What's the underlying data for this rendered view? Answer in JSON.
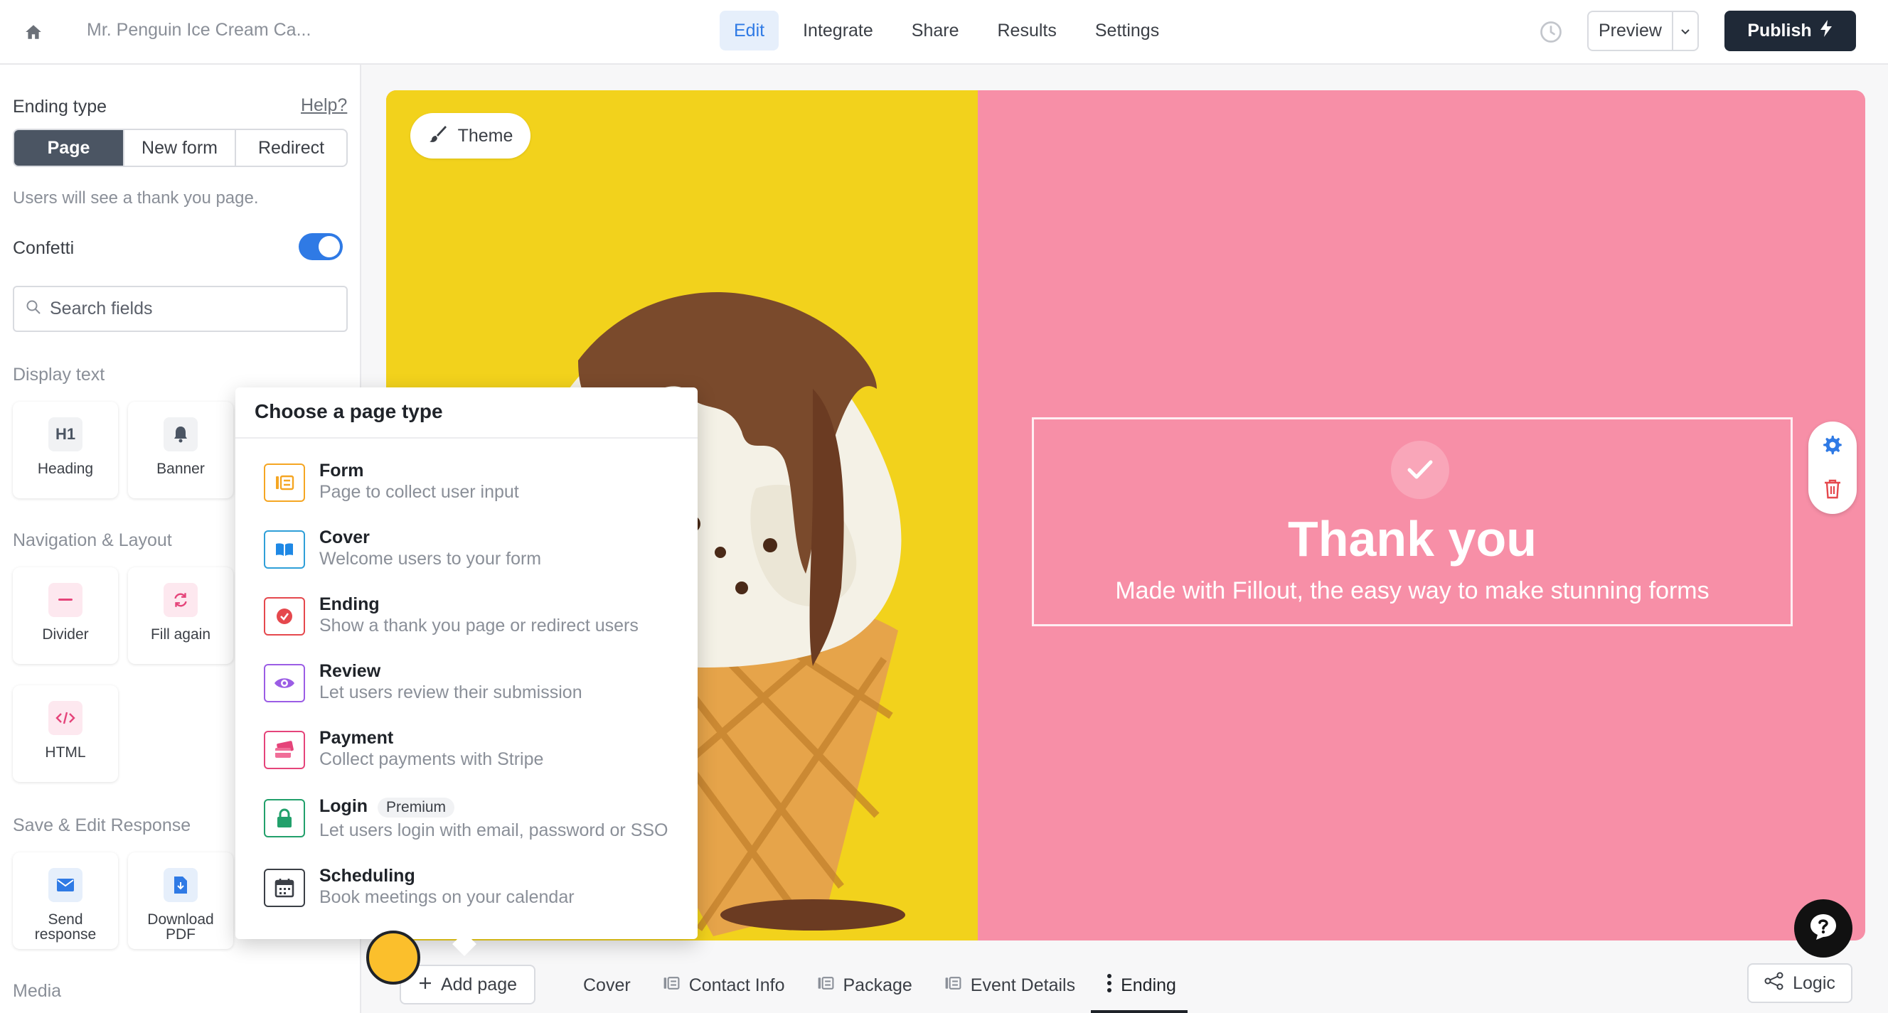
{
  "header": {
    "form_title": "Mr. Penguin Ice Cream Ca...",
    "tabs": [
      {
        "label": "Edit",
        "active": true
      },
      {
        "label": "Integrate"
      },
      {
        "label": "Share"
      },
      {
        "label": "Results"
      },
      {
        "label": "Settings"
      }
    ],
    "preview_label": "Preview",
    "publish_label": "Publish"
  },
  "sidebar": {
    "ending_type_label": "Ending type",
    "help_label": "Help?",
    "ending_options": [
      "Page",
      "New form",
      "Redirect"
    ],
    "selected_ending": "Page",
    "description": "Users will see a thank you page.",
    "confetti_label": "Confetti",
    "confetti_on": true,
    "search_placeholder": "Search fields",
    "sections": {
      "display_text": "Display text",
      "navigation": "Navigation & Layout",
      "save_edit": "Save & Edit Response",
      "media": "Media"
    },
    "tiles": {
      "heading": "Heading",
      "banner": "Banner",
      "divider": "Divider",
      "fill_again": "Fill again",
      "html": "HTML",
      "send_response": "Send response",
      "download_pdf": "Download PDF"
    }
  },
  "canvas": {
    "theme_label": "Theme",
    "thank_you_title": "Thank you",
    "thank_you_subtitle": "Made with Fillout, the easy way to make stunning forms",
    "left_bg": "#f2d21c",
    "right_bg": "#f78fa7"
  },
  "popup": {
    "title": "Choose a page type",
    "items": [
      {
        "name": "Form",
        "desc": "Page to collect user input",
        "icon": "form-icon"
      },
      {
        "name": "Cover",
        "desc": "Welcome users to your form",
        "icon": "cover-icon"
      },
      {
        "name": "Ending",
        "desc": "Show a thank you page or redirect users",
        "icon": "ending-icon"
      },
      {
        "name": "Review",
        "desc": "Let users review their submission",
        "icon": "eye-icon"
      },
      {
        "name": "Payment",
        "desc": "Collect payments with Stripe",
        "icon": "payment-icon"
      },
      {
        "name": "Login",
        "desc": "Let users login with email, password or SSO",
        "icon": "lock-icon",
        "badge": "Premium"
      },
      {
        "name": "Scheduling",
        "desc": "Book meetings on your calendar",
        "icon": "calendar-icon"
      }
    ]
  },
  "bottom": {
    "add_page_label": "Add page",
    "pages": [
      {
        "label": "Cover"
      },
      {
        "label": "Contact Info"
      },
      {
        "label": "Package"
      },
      {
        "label": "Event Details"
      },
      {
        "label": "Ending",
        "active": true
      }
    ],
    "logic_label": "Logic"
  }
}
